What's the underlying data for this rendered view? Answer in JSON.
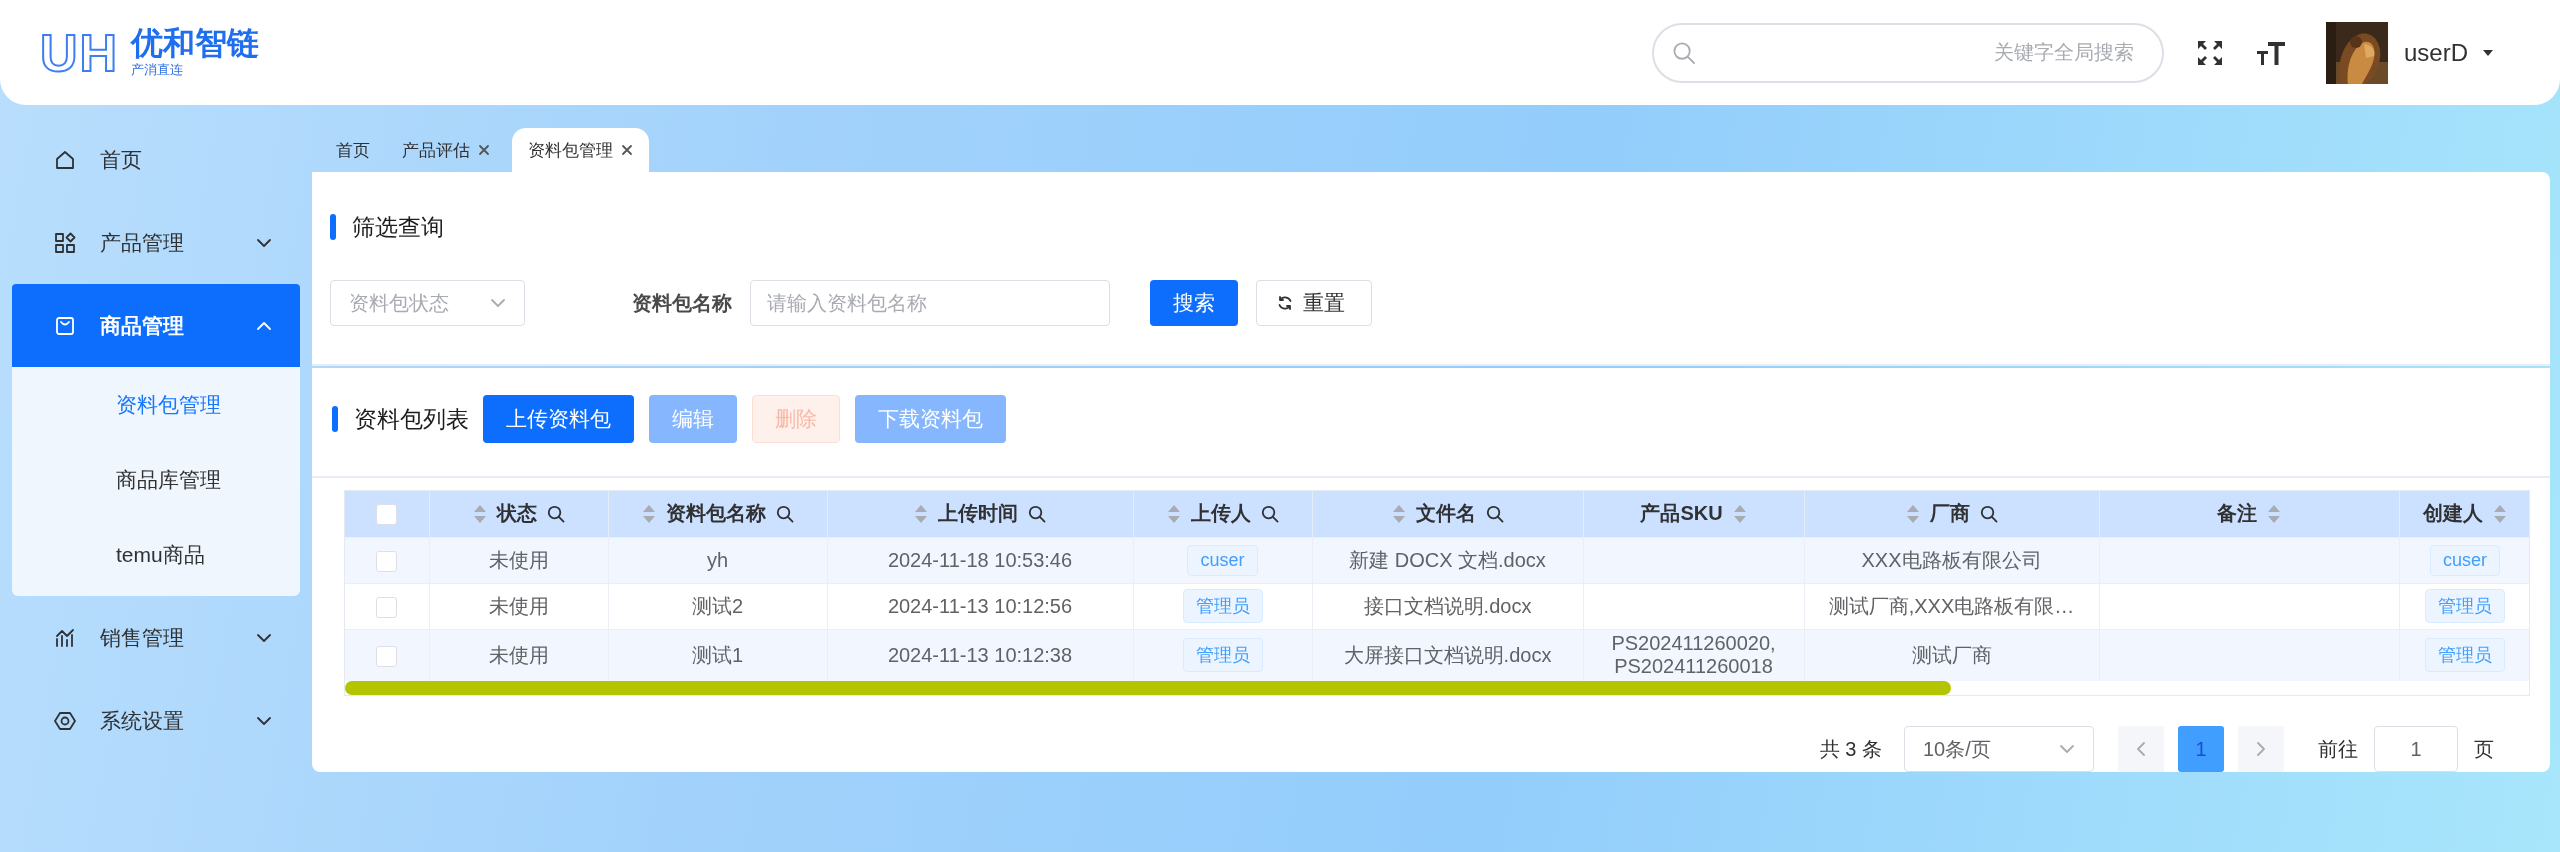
{
  "header": {
    "logo": {
      "mark": "UH",
      "name": "优和智链",
      "tagline": "产消直连"
    },
    "search": {
      "placeholder": "关键字全局搜索"
    },
    "user": {
      "name": "userD"
    }
  },
  "sidebar": {
    "items": [
      {
        "label": "首页",
        "selected": false
      },
      {
        "label": "产品管理",
        "expanded": false,
        "selected": false
      },
      {
        "label": "商品管理",
        "expanded": true,
        "selected": true,
        "children": [
          {
            "label": "资料包管理",
            "selected": true
          },
          {
            "label": "商品库管理",
            "selected": false
          },
          {
            "label": "temu商品",
            "selected": false
          }
        ]
      },
      {
        "label": "销售管理",
        "expanded": false,
        "selected": false
      },
      {
        "label": "系统设置",
        "expanded": false,
        "selected": false
      }
    ]
  },
  "tabs": [
    {
      "label": "首页",
      "selected": false,
      "closable": false
    },
    {
      "label": "产品评估",
      "selected": false,
      "closable": true
    },
    {
      "label": "资料包管理",
      "selected": true,
      "closable": true
    }
  ],
  "filter": {
    "title": "筛选查询",
    "status_select": {
      "placeholder": "资料包状态"
    },
    "name_label": "资料包名称",
    "name_input": {
      "placeholder": "请输入资料包名称"
    },
    "buttons": [
      {
        "label": "搜索",
        "kind": "primary"
      },
      {
        "label": "重置",
        "kind": "reset"
      }
    ]
  },
  "list": {
    "title": "资料包列表",
    "buttons": [
      {
        "label": "上传资料包",
        "kind": "primary",
        "disabled": false
      },
      {
        "label": "编辑",
        "kind": "primary",
        "disabled": true
      },
      {
        "label": "删除",
        "kind": "danger",
        "disabled": true
      },
      {
        "label": "下载资料包",
        "kind": "primary",
        "disabled": true
      }
    ]
  },
  "table": {
    "select_all": {
      "checked": false
    },
    "columns": [
      {
        "title": "状态",
        "search": true,
        "kind": "text"
      },
      {
        "title": "资料包名称",
        "search": true,
        "kind": "text"
      },
      {
        "title": "上传时间",
        "search": true,
        "kind": "text"
      },
      {
        "title": "上传人",
        "search": true,
        "kind": "tag"
      },
      {
        "title": "文件名",
        "search": true,
        "kind": "text"
      },
      {
        "title": "产品SKU",
        "search": false,
        "kind": "text"
      },
      {
        "title": "厂商",
        "search": true,
        "kind": "text"
      },
      {
        "title": "备注",
        "search": false,
        "kind": "text"
      },
      {
        "title": "创建人",
        "search": false,
        "kind": "tag"
      }
    ],
    "rows": [
      {
        "checked": false,
        "cells": [
          "未使用",
          "yh",
          "2024-11-18 10:53:46",
          "cuser",
          "新建 DOCX 文档.docx",
          "",
          "XXX电路板有限公司",
          "",
          "cuser"
        ]
      },
      {
        "checked": false,
        "cells": [
          "未使用",
          "测试2",
          "2024-11-13 10:12:56",
          "管理员",
          "接口文档说明.docx",
          "",
          "测试厂商,XXX电路板有限…",
          "",
          "管理员"
        ]
      },
      {
        "checked": false,
        "cells": [
          "未使用",
          "测试1",
          "2024-11-13 10:12:38",
          "管理员",
          "大屏接口文档说明.docx",
          "PS202411260020,\nPS202411260018",
          "测试厂商",
          "",
          "管理员"
        ]
      }
    ]
  },
  "pagination": {
    "total": "共 3 条",
    "page_size": "10条/页",
    "pages": [
      {
        "label": "1",
        "selected": true
      }
    ],
    "goto_label": "前往",
    "goto_value": "1",
    "goto_suffix": "页"
  }
}
